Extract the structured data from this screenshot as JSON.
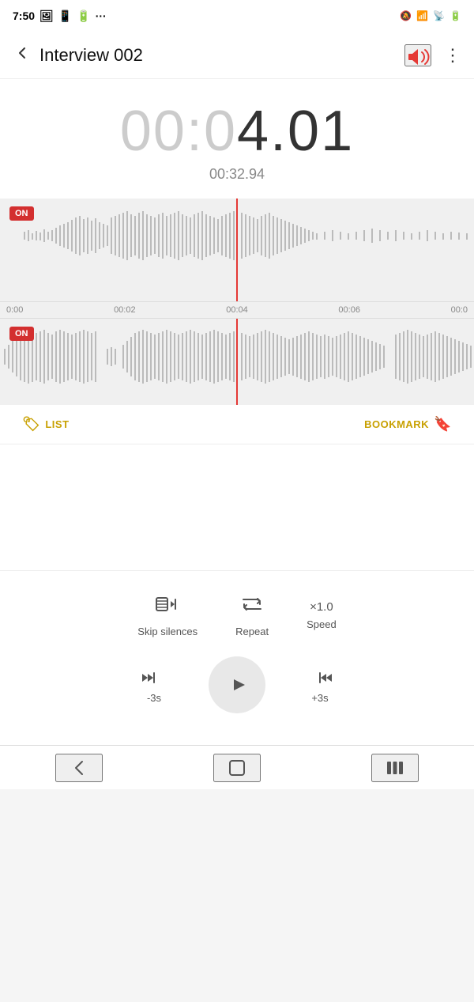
{
  "statusBar": {
    "time": "7:50",
    "rightIcons": [
      "photo",
      "battery",
      "more"
    ],
    "networkIcons": [
      "mute",
      "wifi",
      "signal",
      "battery"
    ]
  },
  "appBar": {
    "title": "Interview 002",
    "backLabel": "‹",
    "moreLabel": "⋮"
  },
  "timer": {
    "dimPart": "00:0",
    "brightPart": "4.01",
    "subTime": "00:32.94"
  },
  "tracks": [
    {
      "id": "track-1",
      "badge": "ON"
    },
    {
      "id": "track-2",
      "badge": "ON"
    }
  ],
  "timeAxis": {
    "labels": [
      "0:00",
      "00:02",
      "00:04",
      "00:06",
      "00:0"
    ]
  },
  "toolbar": {
    "listLabel": "LIST",
    "bookmarkLabel": "BOOKMARK"
  },
  "controls": {
    "skipSilencesLabel": "Skip silences",
    "repeatLabel": "Repeat",
    "speedValue": "×1.0",
    "speedLabel": "Speed"
  },
  "playback": {
    "rewindLabel": "-3s",
    "forwardLabel": "+3s"
  },
  "navBar": {
    "back": "back",
    "home": "home",
    "menu": "menu"
  }
}
